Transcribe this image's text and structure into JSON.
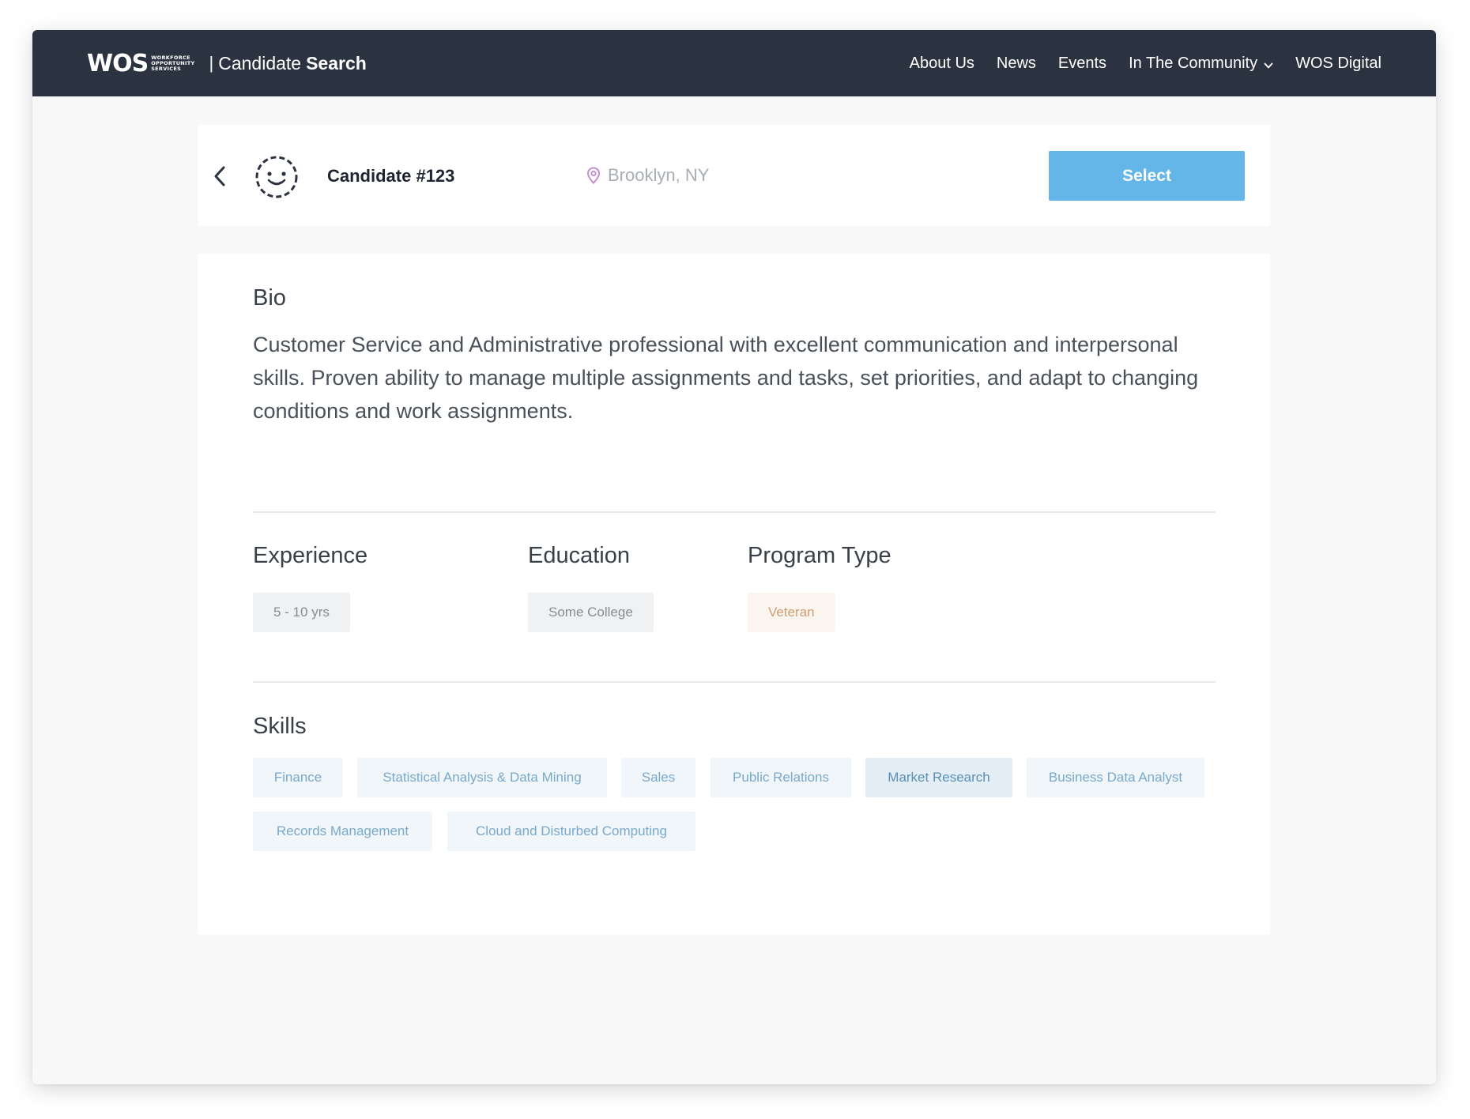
{
  "navbar": {
    "logo_text": "WOS",
    "logo_sub_lines": [
      "WORKFORCE",
      "OPPORTUNITY",
      "SERVICES"
    ],
    "title_light": "Candidate",
    "title_bold": "Search",
    "links": [
      "About Us",
      "News",
      "Events",
      "In The Community",
      "WOS Digital"
    ],
    "dropdown_icon": "chevron-down-icon"
  },
  "candidate": {
    "name": "Candidate #123",
    "location": "Brooklyn, NY",
    "select_label": "Select",
    "avatar_icon": "smiley-avatar-icon"
  },
  "bio": {
    "label": "Bio",
    "text": "Customer Service and Administrative professional with excellent communication and interpersonal skills. Proven ability to manage multiple assignments and tasks, set priorities, and adapt to changing conditions and work assignments."
  },
  "experience": {
    "label": "Experience",
    "value": "5 - 10 yrs"
  },
  "education": {
    "label": "Education",
    "value": "Some College"
  },
  "program_type": {
    "label": "Program Type",
    "value": "Veteran"
  },
  "skills": {
    "label": "Skills",
    "items": [
      "Finance",
      "Statistical Analysis & Data Mining",
      "Sales",
      "Public Relations",
      "Market Research",
      "Business Data Analyst",
      "Records Management",
      "Cloud and Disturbed Computing"
    ],
    "highlighted": "Market Research"
  },
  "colors": {
    "navbar_bg": "#2c3340",
    "select_button": "#64b5e8",
    "skill_tag_bg": "#f1f6fa",
    "skill_tag_text": "#79a9c9",
    "veteran_tag_bg": "#fbf5ef",
    "veteran_tag_text": "#cf9c72",
    "pin_color": "#c58fd6"
  }
}
